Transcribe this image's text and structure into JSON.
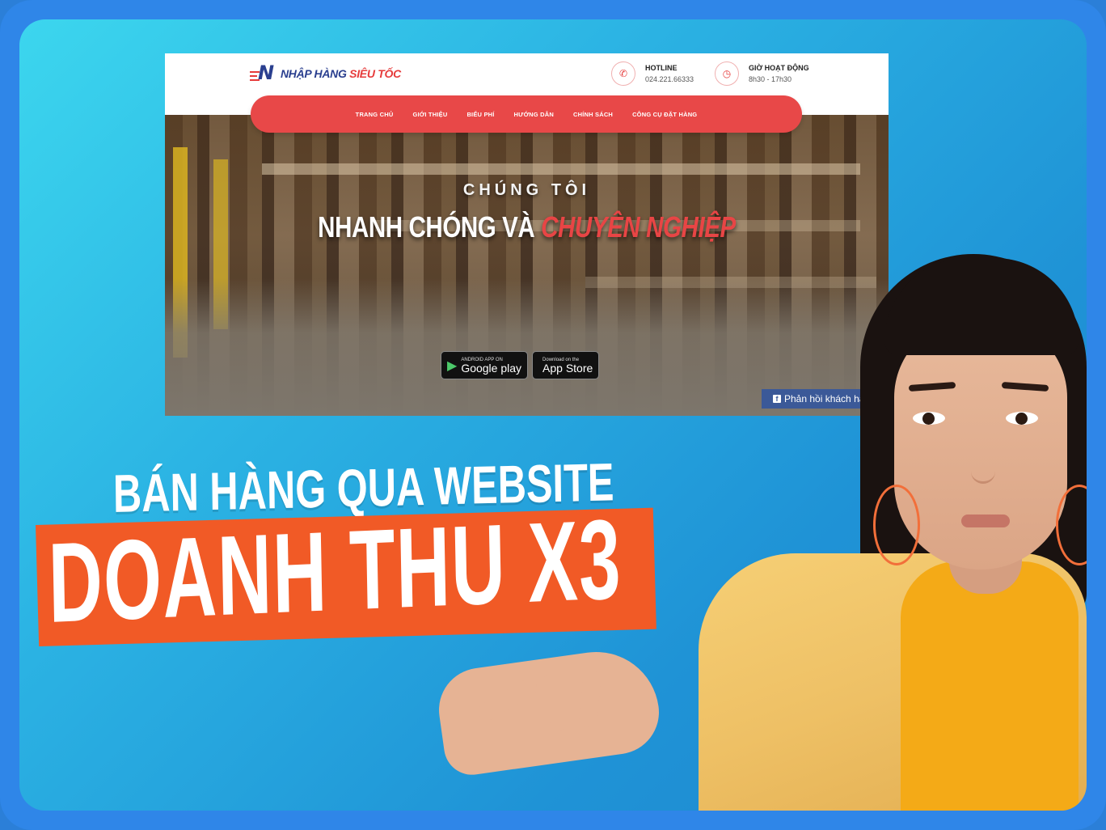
{
  "site": {
    "logo": {
      "prefix": "NHẬP HÀNG ",
      "accent": "SIÊU TỐC",
      "mark": "N"
    },
    "hotline": {
      "title": "HOTLINE",
      "value": "024.221.66333",
      "icon": "phone-icon"
    },
    "hours": {
      "title": "GIỜ HOẠT ĐỘNG",
      "value": "8h30 - 17h30",
      "icon": "clock-icon"
    },
    "nav": [
      "TRANG CHỦ",
      "GIỚI THIỆU",
      "BIỂU PHÍ",
      "HƯỚNG DẪN",
      "CHÍNH SÁCH",
      "CÔNG CỤ ĐẶT HÀNG"
    ],
    "hero": {
      "kicker": "CHÚNG TÔI",
      "title_white": "NHANH CHÓNG VÀ ",
      "title_red": "CHUYÊN NGHIỆP"
    },
    "google_play": {
      "small": "ANDROID APP ON",
      "big": "Google play",
      "icon": "play-icon"
    },
    "app_store": {
      "small": "Download on the",
      "big": "App Store",
      "icon": "apple-icon"
    },
    "feedback": "Phản hồi khách hàng",
    "colors": {
      "brand_red": "#e84848",
      "brand_blue": "#2a3f8f",
      "facebook": "#3b5998"
    }
  },
  "headline": {
    "line1": "BÁN HÀNG QUA WEBSITE",
    "line2": "DOANH THU X3",
    "bar_color": "#f15a26"
  }
}
